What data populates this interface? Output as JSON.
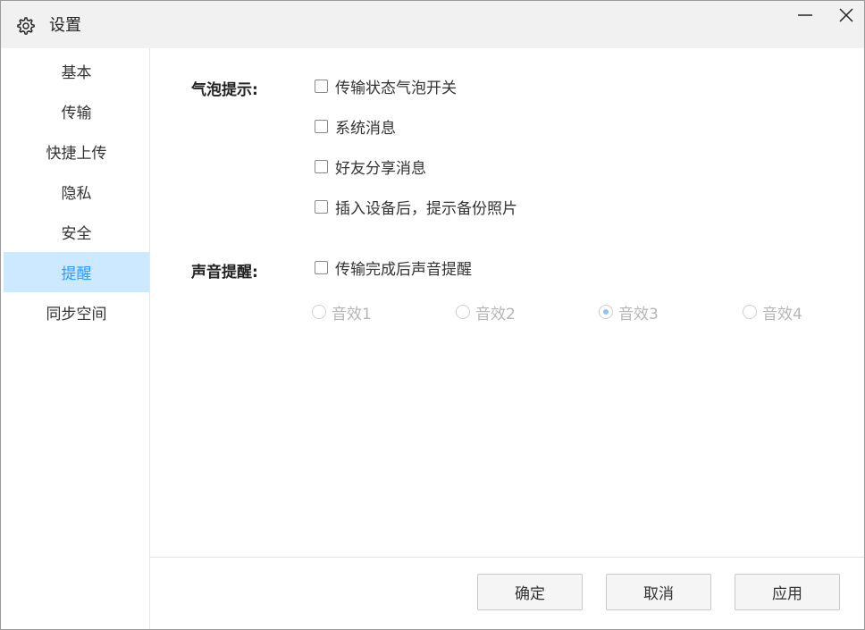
{
  "window": {
    "title": "设置",
    "minimize_glyph": "—",
    "close_glyph": "✕"
  },
  "sidebar": {
    "items": [
      {
        "label": "基本"
      },
      {
        "label": "传输"
      },
      {
        "label": "快捷上传"
      },
      {
        "label": "隐私"
      },
      {
        "label": "安全"
      },
      {
        "label": "提醒",
        "active": true
      },
      {
        "label": "同步空间"
      }
    ]
  },
  "bubble": {
    "label": "气泡提示:",
    "options": [
      {
        "label": "传输状态气泡开关",
        "checked": false
      },
      {
        "label": "系统消息",
        "checked": false
      },
      {
        "label": "好友分享消息",
        "checked": false
      },
      {
        "label": "插入设备后，提示备份照片",
        "checked": false
      }
    ]
  },
  "sound": {
    "label": "声音提醒:",
    "toggle": {
      "label": "传输完成后声音提醒",
      "checked": false
    },
    "effects": [
      {
        "label": "音效1",
        "selected": false
      },
      {
        "label": "音效2",
        "selected": false
      },
      {
        "label": "音效3",
        "selected": true
      },
      {
        "label": "音效4",
        "selected": false
      }
    ]
  },
  "footer": {
    "ok_label": "确定",
    "cancel_label": "取消",
    "apply_label": "应用"
  },
  "colors": {
    "accent": "#2a9bff",
    "active_bg": "#cde9ff",
    "titlebar_bg": "#f1f1f1"
  }
}
